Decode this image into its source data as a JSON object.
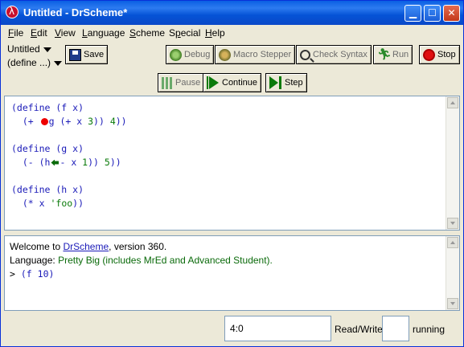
{
  "window": {
    "title": "Untitled - DrScheme*",
    "controls": [
      "minimize",
      "maximize",
      "close"
    ]
  },
  "menu": [
    {
      "label": "File",
      "key": "F",
      "rest": "ile"
    },
    {
      "label": "Edit",
      "key": "E",
      "rest": "dit"
    },
    {
      "label": "View",
      "key": "V",
      "rest": "iew"
    },
    {
      "label": "Language",
      "key": "L",
      "rest": "anguage"
    },
    {
      "label": "Scheme",
      "key": "S",
      "rest": "cheme"
    },
    {
      "label": "Special",
      "key": "p",
      "pre": "S",
      "rest": "ecial"
    },
    {
      "label": "Help",
      "key": "H",
      "rest": "elp"
    }
  ],
  "toolbar": {
    "file_selector": "Untitled",
    "define_selector": "(define ...)",
    "save": "Save",
    "debug": "Debug",
    "macro_stepper": "Macro Stepper",
    "check_syntax": "Check Syntax",
    "run": "Run",
    "stop": "Stop"
  },
  "debugbar": {
    "pause": "Pause",
    "continue": "Continue",
    "step": "Step"
  },
  "editor": {
    "lines": [
      "(define (f x)",
      "  (+ g (+ x 3)) 4))",
      "",
      "(define (g x)",
      "  (- (h - x 1)) 5))",
      "",
      "(define (h x)",
      "  (* x 'foo))"
    ]
  },
  "interactions": {
    "welcome_prefix": "Welcome to ",
    "welcome_link": "DrScheme",
    "welcome_suffix": ", version 360.",
    "language_prefix": "Language: ",
    "language_value": "Pretty Big (includes MrEd and Advanced Student).",
    "prompt": ">",
    "input": "(f 10)"
  },
  "status": {
    "position": "4:0",
    "mode": "Read/Write",
    "state": "running"
  },
  "colors": {
    "keyword": "#1a1ab8",
    "number": "#0a7a0a",
    "breakpoint": "#e00000",
    "titlebar": "#0a5fe3"
  }
}
